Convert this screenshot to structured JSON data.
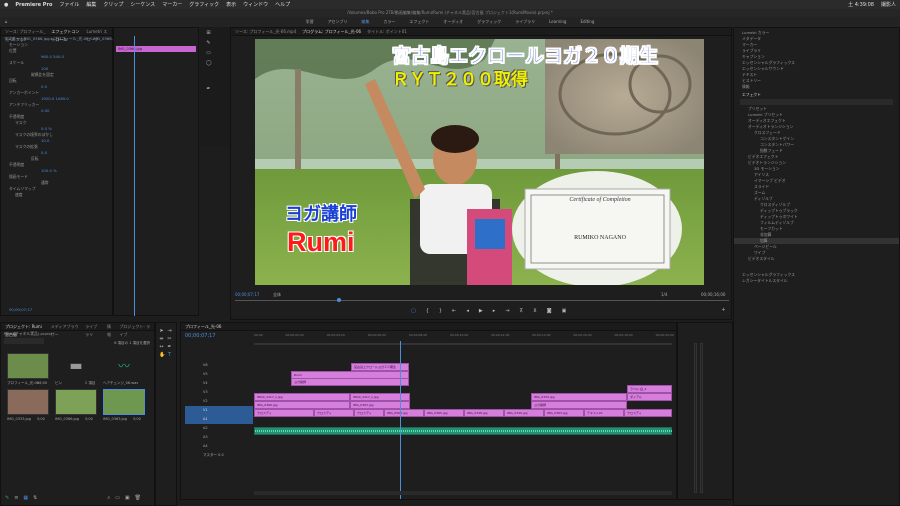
{
  "menubar": {
    "apple": "",
    "app": "Premiere Pro",
    "items": [
      "ファイル",
      "編集",
      "クリップ",
      "シーケンス",
      "マーカー",
      "グラフィック",
      "表示",
      "ウィンドウ",
      "ヘルプ"
    ],
    "clock": "土 4:39:08",
    "user": "撮影人"
  },
  "window_title": "/Volumes/Bobo Pro 2TB/動画編集/編集/Rumi/Rumi (チャネル実品)宮古島 プロジェクト1(RumiMovie).prproj *",
  "workspaces": [
    "学習",
    "アセンブリ",
    "編集",
    "カラー",
    "エフェクト",
    "オーディオ",
    "グラフィック",
    "ライブラリ",
    "Learning",
    "Editing"
  ],
  "effect_controls": {
    "tabs": [
      "ソース: プロフィール_光-06.mp4",
      "エフェクトコントロール",
      "Lumetri スコープ"
    ],
    "source_line": "マスター * IMG_0366.jpg  ▸  プロフィール_光-06 * IMG_0366.jpg  00;00;00;00",
    "clip_label": "IMG_0366.jpg",
    "rows": [
      "モーション",
      "位置",
      "960.0    540.0",
      "スケール",
      "100",
      "縦横比を固定",
      "回転",
      "0.0",
      "アンカーポイント",
      "1920.0   1080.0",
      "アンチフリッカー",
      "0.00",
      "不透明度",
      "マスク",
      "0.0 %",
      "マスクの境界のぼかし",
      "10.0",
      "マスクの拡張",
      "0.0",
      "反転",
      "不透明度",
      "100.0 %",
      "描画モード",
      "通常",
      "タイムリマップ",
      "速度"
    ],
    "timecode": "00;00;07;17"
  },
  "program": {
    "tabs": [
      "ソース: プロフィール_光-06.mp4",
      "プログラム: プロフィール_光-06",
      "タイトル: ポイント01"
    ],
    "timecode_left": "00;00;07;17",
    "fit": "全体",
    "quality": "1/4",
    "timecode_right": "00;00;16;00"
  },
  "video": {
    "title_line1": "宮古島エクロールヨガ２０期生",
    "title_line2": "ＲＹＴ２００取得",
    "subtitle": "ヨガ講師",
    "name": "Rumi",
    "certificate_heading": "Certificate of Completion",
    "certificate_name": "RUMIKO NAGANO"
  },
  "right_panel": {
    "items": [
      "Lumetri カラー",
      "メタデータ",
      "マーカー",
      "ライブラリ",
      "キャプション",
      "エッセンシャルグラフィックス",
      "エッセンシャルサウンド",
      "テキスト",
      "ヒストリー",
      "情報"
    ],
    "effects_header": "エフェクト",
    "tree": [
      "プリセット",
      "Lumetri プリセット",
      "オーディオエフェクト",
      "オーディオトランジション",
      "クロスフェード",
      "コンスタントゲイン",
      "コンスタントパワー",
      "指数フェード",
      "ビデオエフェクト",
      "ビデオトランジション",
      "3D モーション",
      "アイリス",
      "イマーシブ ビデオ",
      "スライド",
      "ズーム",
      "ディゾルブ",
      "クロスディゾルブ",
      "ディップトゥブラック",
      "ディップトゥホワイト",
      "フィルムディゾルブ",
      "モーフカット",
      "非加算",
      "加算",
      "ページピール",
      "ワイプ",
      "ビデオスタイル"
    ],
    "bottom": [
      "エッセンシャルグラフィックス",
      "レガシータイトルスタイル"
    ]
  },
  "project": {
    "tabs": [
      "プロジェクト: Rumi 宮古島",
      "メディアブラウザー",
      "ライブラリ",
      "情報",
      "プロジェクト: ライブ"
    ],
    "filename": "Rumi(チャネル実品).prproj",
    "count": "6 項目の 1 項目を選択",
    "items": [
      {
        "name": "プロフィール_光-06",
        "dur": "16;00"
      },
      {
        "name": "ビン",
        "dur": "2 項目"
      },
      {
        "name": "ヘアチェンジ_06.wav",
        "dur": "1;11;00;15"
      },
      {
        "name": "IMG_0333.jpg",
        "dur": "5;00"
      },
      {
        "name": "IMG_0366.jpg",
        "dur": "5;00"
      },
      {
        "name": "IMG_0363.jpg",
        "dur": "5;00"
      }
    ]
  },
  "timeline": {
    "tab": "プロフィール_光-06",
    "timecode": "00;00;07;17",
    "ruler": [
      "00;00",
      "00;00;02;00",
      "00;00;04;00",
      "00;00;06;00",
      "00;00;08;00",
      "00;00;10;00",
      "00;00;12;00",
      "00;00;14;00",
      "00;00;16;00",
      "00;00;18;00",
      "00;00;20;00"
    ],
    "tracks": [
      "V6",
      "V5",
      "V4",
      "V3",
      "V2",
      "V1",
      "A1",
      "A2",
      "A3",
      "A4",
      "マスター"
    ],
    "master_value": "0.0",
    "clips": [
      "宮古島エクロールヨガ２０期生",
      "Rumi",
      "ヨガ講師",
      "IMG0_2417_s.jpg",
      "IMG0_2417_s.jpg",
      "ラベル:白_2",
      "IMG_0333.jpg",
      "IMG_0366.jpg",
      "IMG_0363.jpg",
      "ヨガ講師",
      "ダイアル",
      "クロスディ",
      "クロスディ",
      "クロスディ",
      "IMG_0563.jpg",
      "IMG_0365.jpg",
      "IMG_0348.jpg",
      "IMG_0349.jpg",
      "IMG_0363.jpg",
      "テキスト01",
      "クロスディ"
    ]
  },
  "colors": {
    "accent": "#4d8fd8",
    "clip_video": "#d57edb",
    "clip_audio": "#2a8f72",
    "title_blue": "#1a3fd6",
    "title_yellow": "#f0f000",
    "name_red": "#ff1a1a"
  }
}
